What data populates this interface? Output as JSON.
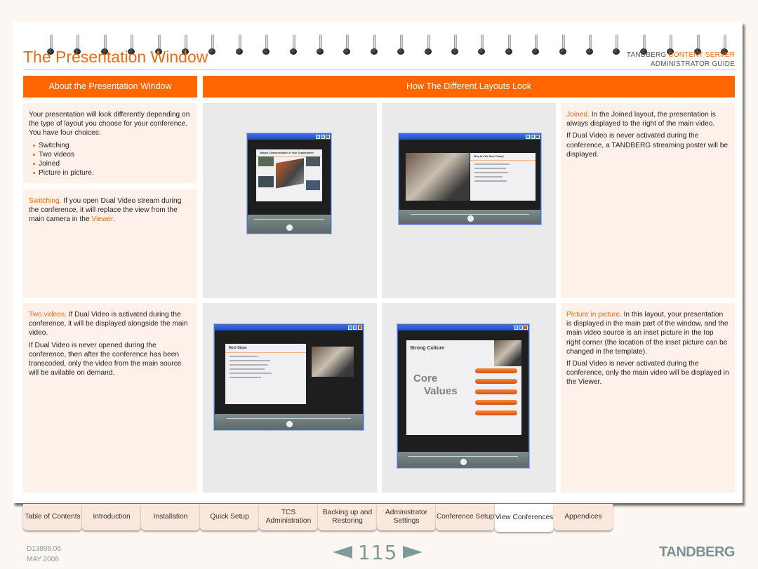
{
  "header": {
    "title": "The Presentation Window",
    "brand_line1_prefix": "TANDBERG ",
    "brand_line1_accent": "CONTENT SERVER",
    "brand_line2": "ADMINISTRATOR GUIDE"
  },
  "sections": {
    "left_header": "About the Presentation Window",
    "right_header": "How The Different Layouts Look"
  },
  "intro": {
    "text": "Your presentation will look differently depending on the type of layout you choose for your conference. You have four choices:",
    "choices": [
      "Switching",
      "Two videos",
      "Joined",
      "Picture in picture."
    ]
  },
  "switching": {
    "term": "Switching.",
    "text_before_link": " If you open Dual Video stream during the conference, it will replace the view from the main camera in the ",
    "link": "Viewer",
    "text_after_link": "."
  },
  "two_videos": {
    "term": "Two videos.",
    "text": " If Dual Video is activated during the conference, it will be displayed alongside the main video.",
    "text2": "If Dual Video is never opened during the conference, then after the conference has been transcoded, only the video from the main source will be avilable on demand."
  },
  "joined": {
    "term": "Joined.",
    "text": " In the Joined layout, the presentation is always displayed to the right of the main video.",
    "text2": "If Dual Video is never activated during the conference, a TANDBERG streaming poster will be displayed."
  },
  "pip": {
    "term": "Picture in picture.",
    "text": " In this layout, your presentation is displayed in the main part of the window, and the main video source is an inset picture in the top right corner (the location of the inset picture can be changed in the template).",
    "text2": "If Dual Video is never activated during the conference, only the main video will be displayed in the Viewer."
  },
  "screenshots": {
    "switching": {
      "slide_title": "Natural Communication in Your Organisation"
    },
    "joined": {
      "slide_title": "Why Are We Here Today?"
    },
    "two_videos": {
      "slide_title": "Next Steps"
    },
    "pip": {
      "slide_title": "Strong Culture",
      "core_line1": "Core",
      "core_line2": "Values"
    }
  },
  "nav_tabs": [
    {
      "label": "Table of Contents",
      "active": false
    },
    {
      "label": "Introduction",
      "active": false
    },
    {
      "label": "Installation",
      "active": false
    },
    {
      "label": "Quick Setup",
      "active": false
    },
    {
      "label": "TCS Administration",
      "active": false
    },
    {
      "label": "Backing up and Restoring",
      "active": false
    },
    {
      "label": "Administrator Settings",
      "active": false
    },
    {
      "label": "Conference Setup",
      "active": false
    },
    {
      "label": "View Conferences",
      "active": true
    },
    {
      "label": "Appendices",
      "active": false
    }
  ],
  "footer": {
    "doc_number": "D13898.06",
    "date": "MAY 2008",
    "page_number": "115",
    "logo": "TANDBERG"
  },
  "colors": {
    "accent": "#ff6600",
    "panel_bg": "#fdf1ea",
    "tab_bg": "#fbe8dd",
    "footer_gray": "#809a99"
  }
}
